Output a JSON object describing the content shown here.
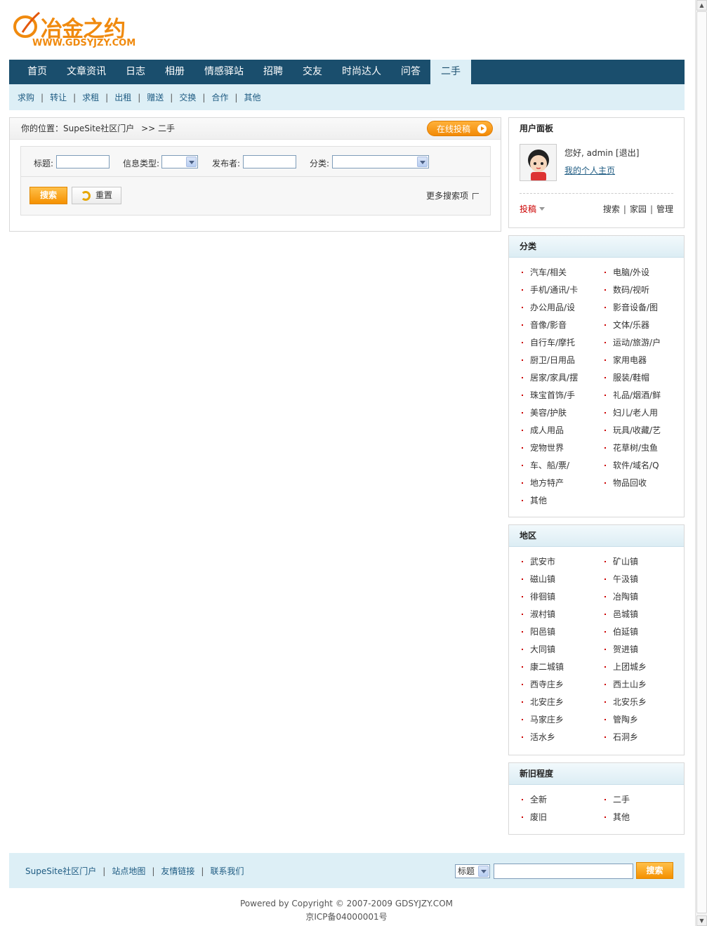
{
  "logo": {
    "brand": "冶金之约",
    "url": "WWW.GDSYJZY.COM"
  },
  "main_nav": [
    "首页",
    "文章资讯",
    "日志",
    "相册",
    "情感驿站",
    "招聘",
    "交友",
    "时尚达人",
    "问答",
    "二手"
  ],
  "main_nav_active": "二手",
  "sub_nav": [
    "求购",
    "转让",
    "求租",
    "出租",
    "赠送",
    "交换",
    "合作",
    "其他"
  ],
  "breadcrumb": {
    "prefix": "你的位置：",
    "home": "SupeSite社区门户",
    "sep": ">>",
    "current": "二手"
  },
  "post_button": "在线投稿",
  "search_form": {
    "title_label": "标题:",
    "title_value": "",
    "type_label": "信息类型:",
    "type_value": "",
    "author_label": "发布者:",
    "author_value": "",
    "category_label": "分类:",
    "category_value": "",
    "search_button": "搜索",
    "reset_button": "重置",
    "more_search": "更多搜索项"
  },
  "user_panel": {
    "title": "用户面板",
    "greeting": "您好, admin [退出]",
    "home_link": "我的个人主页",
    "post_link": "投稿",
    "links": [
      "搜索",
      "家园",
      "管理"
    ]
  },
  "categories": {
    "title": "分类",
    "items": [
      "汽车/相关",
      "电脑/外设",
      "手机/通讯/卡",
      "数码/视听",
      "办公用品/设",
      "影音设备/图",
      "音像/影音",
      "文体/乐器",
      "自行车/摩托",
      "运动/旅游/户",
      "厨卫/日用品",
      "家用电器",
      "居家/家具/摆",
      "服装/鞋帽",
      "珠宝首饰/手",
      "礼品/烟酒/鲜",
      "美容/护肤",
      "妇儿/老人用",
      "成人用品",
      "玩具/收藏/艺",
      "宠物世界",
      "花草树/虫鱼",
      "车、船/票/",
      "软件/域名/Q",
      "地方特产",
      "物品回收",
      "其他"
    ]
  },
  "regions": {
    "title": "地区",
    "items": [
      "武安市",
      "矿山镇",
      "磁山镇",
      "午汲镇",
      "徘徊镇",
      "冶陶镇",
      "淑村镇",
      "邑城镇",
      "阳邑镇",
      "伯延镇",
      "大同镇",
      "贺进镇",
      "康二城镇",
      "上团城乡",
      "西寺庄乡",
      "西土山乡",
      "北安庄乡",
      "北安乐乡",
      "马家庄乡",
      "管陶乡",
      "活水乡",
      "石洞乡"
    ]
  },
  "condition": {
    "title": "新旧程度",
    "items": [
      "全新",
      "二手",
      "废旧",
      "其他"
    ]
  },
  "footer": {
    "links": [
      "SupeSite社区门户",
      "站点地图",
      "友情链接",
      "联系我们"
    ],
    "search_select": "标题",
    "search_value": "",
    "search_button": "搜索"
  },
  "copyright": {
    "line1": "Powered by Copyright © 2007-2009 GDSYJZY.COM",
    "line2": "京ICP备04000001号"
  },
  "colors": {
    "nav": "#1a4e6d",
    "subnav": "#ddeff6",
    "accent": "#f59100",
    "link": "#1e5b82"
  }
}
